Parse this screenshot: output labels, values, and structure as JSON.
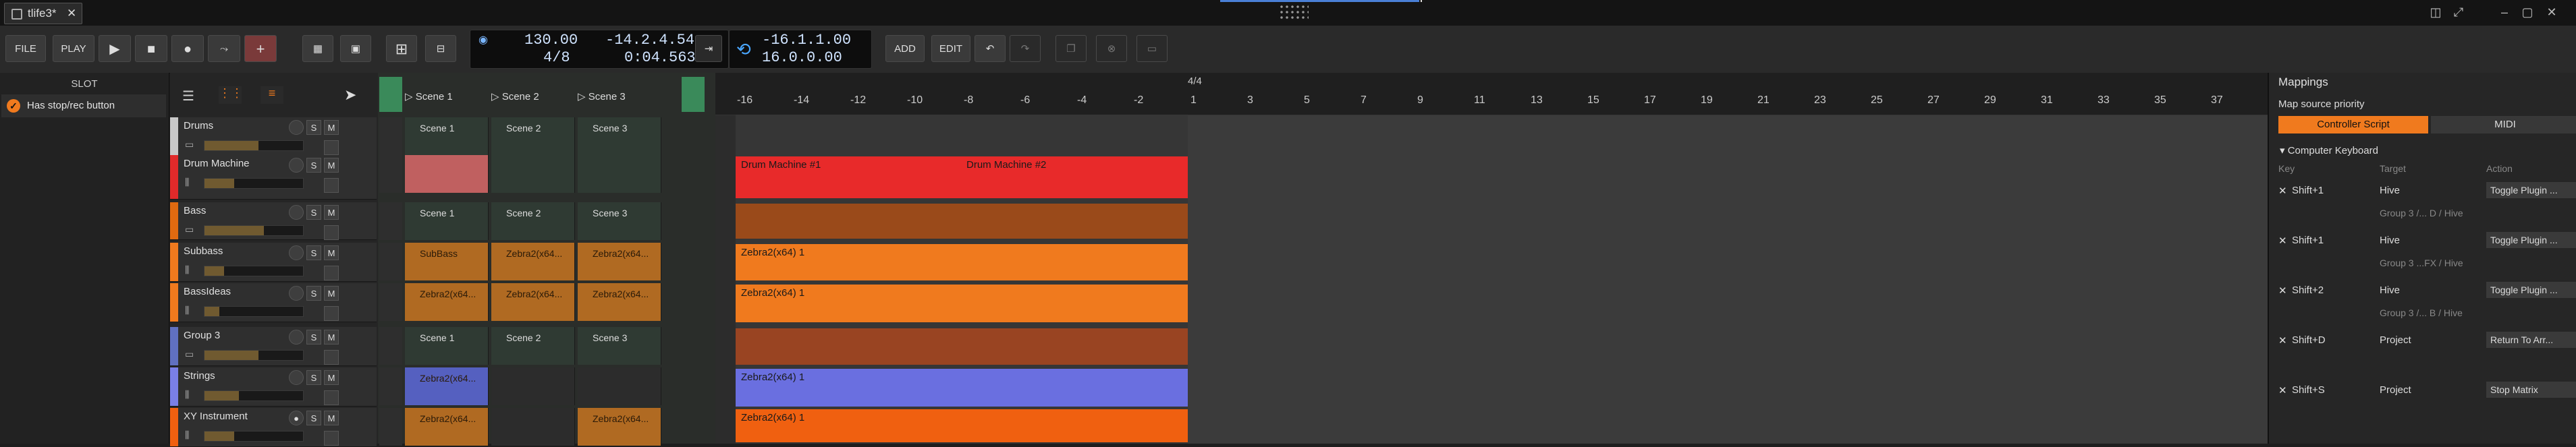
{
  "window": {
    "tab_title": "tlife3*",
    "tab_close": "✕"
  },
  "toolbar": {
    "file": "FILE",
    "play_label": "PLAY",
    "add": "ADD",
    "edit": "EDIT",
    "tempo": "130.00",
    "time_sig": "4/8",
    "position_bars": "-14.2.4.54",
    "position_time": "0:04.563",
    "loop_start": "-16.1.1.00",
    "loop_len": "16.0.0.00"
  },
  "slot_panel": {
    "header": "SLOT",
    "option": "Has stop/rec button"
  },
  "scenes_header": [
    "Scene 1",
    "Scene 2",
    "Scene 3"
  ],
  "tracks": [
    {
      "name": "Drums",
      "color": "#c8c8c8",
      "cells": [
        "Scene 1",
        "Scene 2",
        "Scene 3"
      ],
      "fader": 0.55
    },
    {
      "name": "Drum Machine",
      "color": "#e02a2a",
      "cells": [
        "",
        "",
        ""
      ],
      "fader": 0.3
    },
    {
      "name": "Bass",
      "color": "#e06a10",
      "cells": [
        "Scene 1",
        "Scene 2",
        "Scene 3"
      ],
      "fader": 0.6
    },
    {
      "name": "Subbass",
      "color": "#f07a1e",
      "cells": [
        "SubBass",
        "Zebra2(x64...",
        "Zebra2(x64..."
      ],
      "fader": 0.2
    },
    {
      "name": "BassIdeas",
      "color": "#f07a1e",
      "cells": [
        "Zebra2(x64...",
        "Zebra2(x64...",
        "Zebra2(x64..."
      ],
      "fader": 0.15
    },
    {
      "name": "Group 3",
      "color": "#6070c0",
      "cells": [
        "Scene 1",
        "Scene 2",
        "Scene 3"
      ],
      "fader": 0.55
    },
    {
      "name": "Strings",
      "color": "#7a7fe6",
      "cells": [
        "Zebra2(x64...",
        "",
        ""
      ],
      "fader": 0.35
    },
    {
      "name": "XY Instrument",
      "color": "#f06010",
      "cells": [
        "Zebra2(x64...",
        "",
        "Zebra2(x64..."
      ],
      "fader": 0.3
    }
  ],
  "ruler": {
    "signature": "4/4",
    "ticks": [
      "-16",
      "-14",
      "-12",
      "-10",
      "-8",
      "-6",
      "-4",
      "-2",
      "1",
      "3",
      "5",
      "7",
      "9",
      "11",
      "13",
      "15",
      "17",
      "19",
      "21",
      "23",
      "25",
      "27",
      "29",
      "31",
      "33",
      "35",
      "37"
    ]
  },
  "arranger_clips": {
    "drum_machine_1": "Drum Machine #1",
    "drum_machine_2": "Drum Machine #2",
    "subbass": "Zebra2(x64) 1",
    "bassideas": "Zebra2(x64) 1",
    "strings": "Zebra2(x64) 1",
    "xy": "Zebra2(x64) 1"
  },
  "inspector": {
    "title": "Mappings",
    "source_priority": "Map source priority",
    "tab_controller": "Controller Script",
    "tab_midi": "MIDI",
    "section": "Computer Keyboard",
    "col_key": "Key",
    "col_target": "Target",
    "col_action": "Action",
    "rows": [
      {
        "key": "Shift+1",
        "target": "Hive",
        "action": "Toggle Plugin ...",
        "sub": "Group 3 /... D / Hive"
      },
      {
        "key": "Shift+1",
        "target": "Hive",
        "action": "Toggle Plugin ...",
        "sub": "Group 3 ...FX / Hive"
      },
      {
        "key": "Shift+2",
        "target": "Hive",
        "action": "Toggle Plugin ...",
        "sub": "Group 3 /... B / Hive"
      },
      {
        "key": "Shift+D",
        "target": "Project",
        "action": "Return To Arr...",
        "sub": ""
      },
      {
        "key": "Shift+S",
        "target": "Project",
        "action": "Stop Matrix",
        "sub": ""
      }
    ]
  },
  "colors": {
    "accent": "#f07a1e",
    "clip_red": "#e82a2a",
    "clip_orange": "#f07a1e",
    "clip_blue": "#6a6fe0"
  }
}
